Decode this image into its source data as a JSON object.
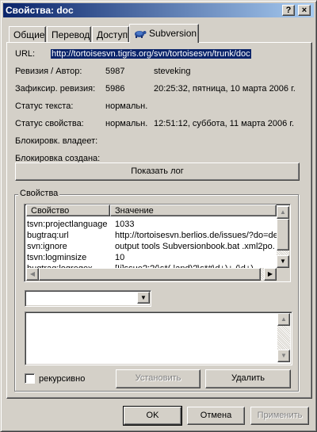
{
  "window": {
    "title": "Свойства: doc",
    "help_button": "?",
    "close_button": "×"
  },
  "tabs": [
    {
      "label": "Общие"
    },
    {
      "label": "Перевод"
    },
    {
      "label": "Доступ"
    },
    {
      "label": "Subversion",
      "icon": "tortoise-icon"
    }
  ],
  "svn": {
    "url_label": "URL:",
    "url_value": "http://tortoisesvn.tigris.org/svn/tortoisesvn/trunk/doc",
    "rev_label": "Ревизия / Автор:",
    "rev_value": "5987",
    "author_value": "steveking",
    "commit_label": "Зафиксир. ревизия:",
    "commit_value": "5986",
    "commit_date": "20:25:32, пятница, 10 марта 2006 г.",
    "text_status_label": "Статус текста:",
    "text_status_value": "нормальн.",
    "prop_status_label": "Статус свойства:",
    "prop_status_value": "нормальн.",
    "prop_status_date": "12:51:12, суббота, 11 марта 2006 г.",
    "lock_owner_label": "Блокировк. владеет:",
    "lock_created_label": "Блокировка создана:",
    "show_log_button": "Показать лог"
  },
  "properties": {
    "group_label": "Свойства",
    "columns": [
      "Свойство",
      "Значение"
    ],
    "rows": [
      {
        "name": "tsvn:projectlanguage",
        "value": "1033"
      },
      {
        "name": "bugtraq:url",
        "value": "http://tortoisesvn.berlios.de/issues/?do=de"
      },
      {
        "name": "svn:ignore",
        "value": "output  tools  Subversionbook.bat  .xml2po."
      },
      {
        "name": "tsvn:logminsize",
        "value": "10"
      },
      {
        "name": "bugtraq:logregex",
        "value": "[Ii]ssue?:?(\\s*(,|and)?\\s*#\\d+)+  (\\d+)"
      }
    ],
    "dropdown_value": "",
    "recursive_label": "рекурсивно",
    "set_button": "Установить",
    "delete_button": "Удалить"
  },
  "footer": {
    "ok": "OK",
    "cancel": "Отмена",
    "apply": "Применить"
  },
  "colors": {
    "selection": "#0a246a",
    "face": "#d4d0c8"
  }
}
